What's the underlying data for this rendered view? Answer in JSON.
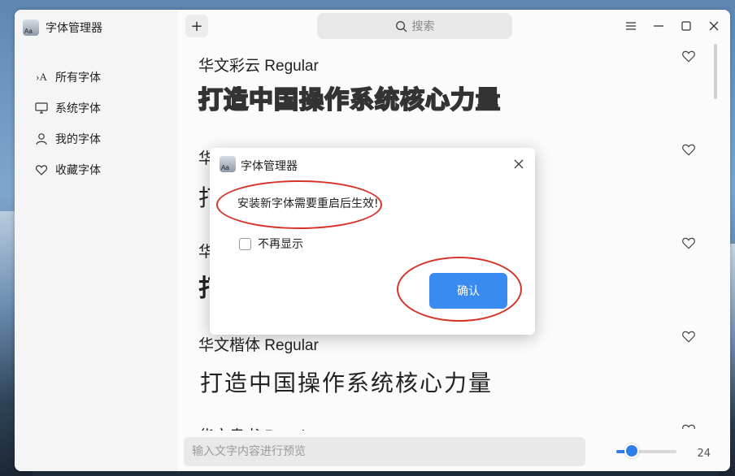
{
  "app": {
    "title": "字体管理器",
    "icon_text": "Aa"
  },
  "sidebar": {
    "items": [
      {
        "label": "所有字体",
        "icon": "all-fonts-icon",
        "glyph": "›A"
      },
      {
        "label": "系统字体",
        "icon": "monitor-icon",
        "glyph": "▭"
      },
      {
        "label": "我的字体",
        "icon": "user-icon",
        "glyph": "◯"
      },
      {
        "label": "收藏字体",
        "icon": "heart-icon",
        "glyph": "♡"
      }
    ]
  },
  "toolbar": {
    "add_label": "+",
    "search_placeholder": "搜索"
  },
  "fonts": [
    {
      "name": "华文彩云 Regular",
      "sample": "打造中国操作系统核心力量"
    },
    {
      "name": "华",
      "sample": "打"
    },
    {
      "name": "华",
      "sample": "打"
    },
    {
      "name": "华文楷体 Regular",
      "sample": "打造中国操作系统核心力量"
    },
    {
      "name": "华文隶书 Regular"
    }
  ],
  "preview": {
    "placeholder": "输入文字内容进行预览",
    "size": "24",
    "size_fraction": 0.3
  },
  "dialog": {
    "title": "字体管理器",
    "message": "安装新字体需要重启后生效!",
    "checkbox_label": "不再显示",
    "confirm_label": "确认"
  },
  "colors": {
    "accent": "#3a8bf0",
    "highlight_ring": "#d63228"
  }
}
